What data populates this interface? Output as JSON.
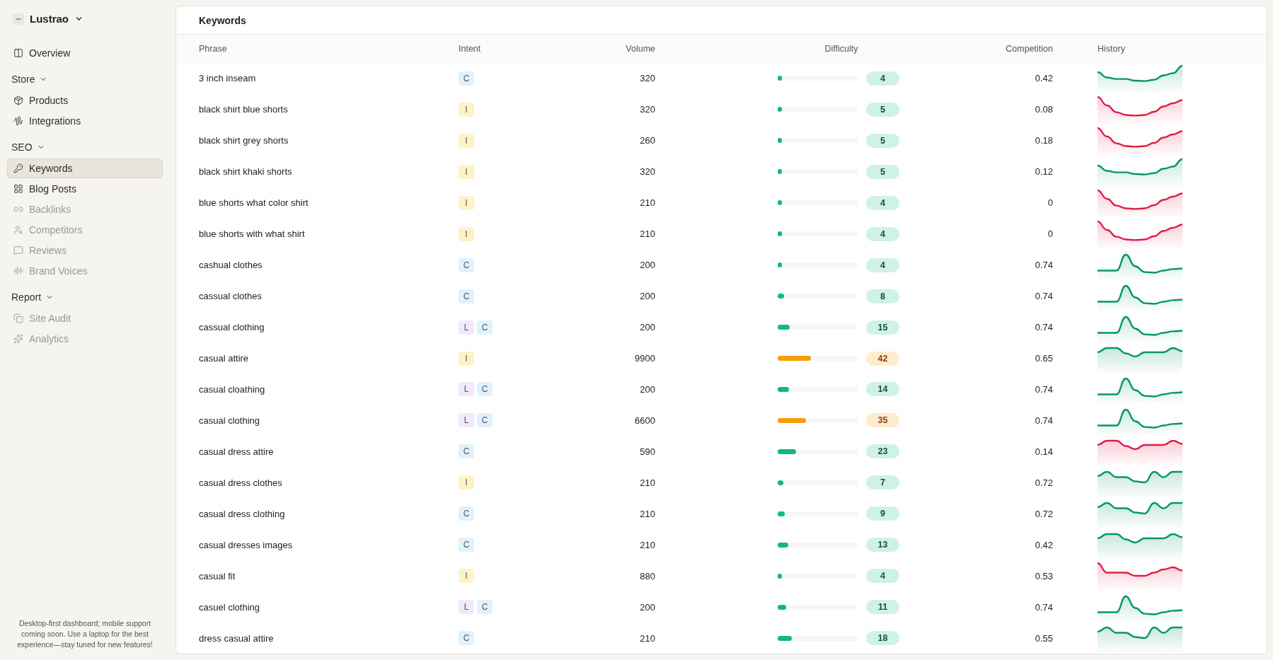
{
  "sidebar": {
    "brand": "Lustrao",
    "top_items": [
      {
        "label": "Overview",
        "selected": false,
        "disabled": false
      }
    ],
    "sections": [
      {
        "title": "Store",
        "expanded": true,
        "items": [
          {
            "label": "Products",
            "selected": false,
            "disabled": false
          },
          {
            "label": "Integrations",
            "selected": false,
            "disabled": false
          }
        ]
      },
      {
        "title": "SEO",
        "expanded": true,
        "items": [
          {
            "label": "Keywords",
            "selected": true,
            "disabled": false
          },
          {
            "label": "Blog Posts",
            "selected": false,
            "disabled": false
          },
          {
            "label": "Backlinks",
            "selected": false,
            "disabled": true
          },
          {
            "label": "Competitors",
            "selected": false,
            "disabled": true
          },
          {
            "label": "Reviews",
            "selected": false,
            "disabled": true
          },
          {
            "label": "Brand Voices",
            "selected": false,
            "disabled": true
          }
        ]
      },
      {
        "title": "Report",
        "expanded": true,
        "items": [
          {
            "label": "Site Audit",
            "selected": false,
            "disabled": true
          },
          {
            "label": "Analytics",
            "selected": false,
            "disabled": true
          }
        ]
      }
    ],
    "footer_note": "Desktop-first dashboard; mobile support coming soon. Use a laptop for the best experience—stay tuned for new features!"
  },
  "panel": {
    "title": "Keywords",
    "columns": [
      "Phrase",
      "Intent",
      "Volume",
      "Difficulty",
      "Competition",
      "History"
    ],
    "rows": [
      {
        "phrase": "3 inch inseam",
        "intent": [
          {
            "code": "C",
            "color": "#e0f2fe"
          }
        ],
        "volume": "320",
        "difficulty": {
          "value": "4",
          "level": 0.04,
          "color": "#10b981"
        },
        "competition": "0.42",
        "history": {
          "kind": "rise",
          "color": "#059669"
        }
      },
      {
        "phrase": "black shirt blue shorts",
        "intent": [
          {
            "code": "I",
            "color": "#fef3c7"
          }
        ],
        "volume": "320",
        "difficulty": {
          "value": "5",
          "level": 0.05,
          "color": "#10b981"
        },
        "competition": "0.08",
        "history": {
          "kind": "valley",
          "color": "#e11d48"
        }
      },
      {
        "phrase": "black shirt grey shorts",
        "intent": [
          {
            "code": "I",
            "color": "#fef3c7"
          }
        ],
        "volume": "260",
        "difficulty": {
          "value": "5",
          "level": 0.05,
          "color": "#10b981"
        },
        "competition": "0.18",
        "history": {
          "kind": "valley",
          "color": "#e11d48"
        }
      },
      {
        "phrase": "black shirt khaki shorts",
        "intent": [
          {
            "code": "I",
            "color": "#fef3c7"
          }
        ],
        "volume": "320",
        "difficulty": {
          "value": "5",
          "level": 0.05,
          "color": "#10b981"
        },
        "competition": "0.12",
        "history": {
          "kind": "rise",
          "color": "#059669"
        }
      },
      {
        "phrase": "blue shorts what color shirt",
        "intent": [
          {
            "code": "I",
            "color": "#fef3c7"
          }
        ],
        "volume": "210",
        "difficulty": {
          "value": "4",
          "level": 0.04,
          "color": "#10b981"
        },
        "competition": "0",
        "history": {
          "kind": "valley",
          "color": "#e11d48"
        }
      },
      {
        "phrase": "blue shorts with what shirt",
        "intent": [
          {
            "code": "I",
            "color": "#fef3c7"
          }
        ],
        "volume": "210",
        "difficulty": {
          "value": "4",
          "level": 0.04,
          "color": "#10b981"
        },
        "competition": "0",
        "history": {
          "kind": "valley",
          "color": "#e11d48"
        }
      },
      {
        "phrase": "cashual clothes",
        "intent": [
          {
            "code": "C",
            "color": "#e0f2fe"
          }
        ],
        "volume": "200",
        "difficulty": {
          "value": "4",
          "level": 0.04,
          "color": "#10b981"
        },
        "competition": "0.74",
        "history": {
          "kind": "peak",
          "color": "#059669"
        }
      },
      {
        "phrase": "cassual clothes",
        "intent": [
          {
            "code": "C",
            "color": "#e0f2fe"
          }
        ],
        "volume": "200",
        "difficulty": {
          "value": "8",
          "level": 0.08,
          "color": "#10b981"
        },
        "competition": "0.74",
        "history": {
          "kind": "peak",
          "color": "#059669"
        }
      },
      {
        "phrase": "cassual clothing",
        "intent": [
          {
            "code": "L",
            "color": "#f3e8ff"
          },
          {
            "code": "C",
            "color": "#e0f2fe"
          }
        ],
        "volume": "200",
        "difficulty": {
          "value": "15",
          "level": 0.15,
          "color": "#10b981"
        },
        "competition": "0.74",
        "history": {
          "kind": "peak",
          "color": "#059669"
        }
      },
      {
        "phrase": "casual attire",
        "intent": [
          {
            "code": "I",
            "color": "#fef3c7"
          }
        ],
        "volume": "9900",
        "difficulty": {
          "value": "42",
          "level": 0.42,
          "color": "#f59e0b"
        },
        "competition": "0.65",
        "history": {
          "kind": "plateau",
          "color": "#059669"
        }
      },
      {
        "phrase": "casual cloathing",
        "intent": [
          {
            "code": "L",
            "color": "#f3e8ff"
          },
          {
            "code": "C",
            "color": "#e0f2fe"
          }
        ],
        "volume": "200",
        "difficulty": {
          "value": "14",
          "level": 0.14,
          "color": "#10b981"
        },
        "competition": "0.74",
        "history": {
          "kind": "peak",
          "color": "#059669"
        }
      },
      {
        "phrase": "casual clothing",
        "intent": [
          {
            "code": "L",
            "color": "#f3e8ff"
          },
          {
            "code": "C",
            "color": "#e0f2fe"
          }
        ],
        "volume": "6600",
        "difficulty": {
          "value": "35",
          "level": 0.35,
          "color": "#f59e0b"
        },
        "competition": "0.74",
        "history": {
          "kind": "peak",
          "color": "#059669"
        }
      },
      {
        "phrase": "casual dress attire",
        "intent": [
          {
            "code": "C",
            "color": "#e0f2fe"
          }
        ],
        "volume": "590",
        "difficulty": {
          "value": "23",
          "level": 0.23,
          "color": "#10b981"
        },
        "competition": "0.14",
        "history": {
          "kind": "plateau",
          "color": "#e11d48"
        }
      },
      {
        "phrase": "casual dress clothes",
        "intent": [
          {
            "code": "I",
            "color": "#fef3c7"
          }
        ],
        "volume": "210",
        "difficulty": {
          "value": "7",
          "level": 0.07,
          "color": "#10b981"
        },
        "competition": "0.72",
        "history": {
          "kind": "wave",
          "color": "#059669"
        }
      },
      {
        "phrase": "casual dress clothing",
        "intent": [
          {
            "code": "C",
            "color": "#e0f2fe"
          }
        ],
        "volume": "210",
        "difficulty": {
          "value": "9",
          "level": 0.09,
          "color": "#10b981"
        },
        "competition": "0.72",
        "history": {
          "kind": "wave",
          "color": "#059669"
        }
      },
      {
        "phrase": "casual dresses images",
        "intent": [
          {
            "code": "C",
            "color": "#e0f2fe"
          }
        ],
        "volume": "210",
        "difficulty": {
          "value": "13",
          "level": 0.13,
          "color": "#10b981"
        },
        "competition": "0.42",
        "history": {
          "kind": "plateau",
          "color": "#059669"
        }
      },
      {
        "phrase": "casual fit",
        "intent": [
          {
            "code": "I",
            "color": "#fef3c7"
          }
        ],
        "volume": "880",
        "difficulty": {
          "value": "4",
          "level": 0.04,
          "color": "#10b981"
        },
        "competition": "0.53",
        "history": {
          "kind": "dip",
          "color": "#e11d48"
        }
      },
      {
        "phrase": "casuel clothing",
        "intent": [
          {
            "code": "L",
            "color": "#f3e8ff"
          },
          {
            "code": "C",
            "color": "#e0f2fe"
          }
        ],
        "volume": "200",
        "difficulty": {
          "value": "11",
          "level": 0.11,
          "color": "#10b981"
        },
        "competition": "0.74",
        "history": {
          "kind": "peak",
          "color": "#059669"
        }
      },
      {
        "phrase": "dress casual attire",
        "intent": [
          {
            "code": "C",
            "color": "#e0f2fe"
          }
        ],
        "volume": "210",
        "difficulty": {
          "value": "18",
          "level": 0.18,
          "color": "#10b981"
        },
        "competition": "0.55",
        "history": {
          "kind": "wave",
          "color": "#059669"
        }
      }
    ]
  }
}
